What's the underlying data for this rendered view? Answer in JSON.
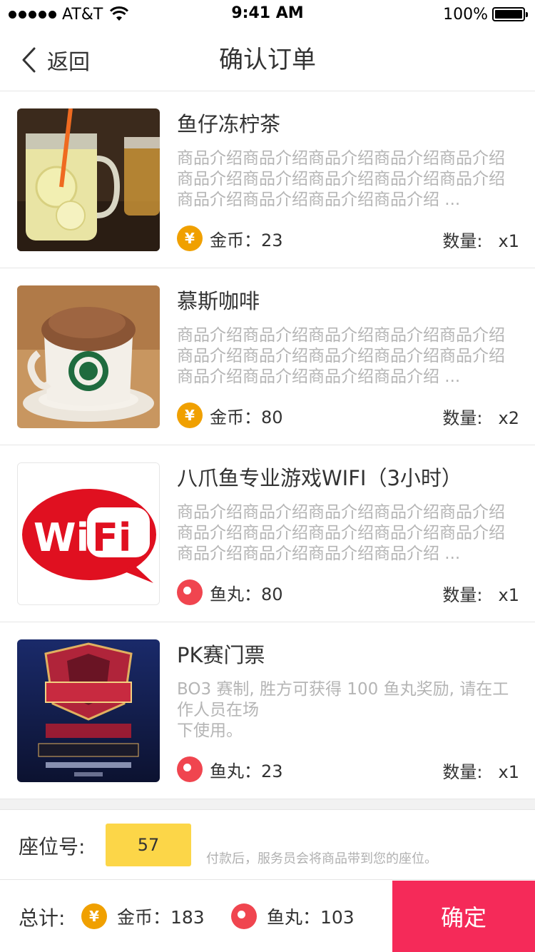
{
  "status_bar": {
    "carrier": "AT&T",
    "time": "9:41 AM",
    "battery": "100%"
  },
  "nav": {
    "back_label": "返回",
    "title": "确认订单"
  },
  "items": [
    {
      "title": "鱼仔冻柠茶",
      "desc": "商品介绍商品介绍商品介绍商品介绍商品介绍商品介绍商品介绍商品介绍商品介绍商品介绍商品介绍商品介绍商品介绍商品介绍 ...",
      "price_label": "金币：23",
      "currency_icon": "coin-icon",
      "qty_label": "数量:",
      "qty_value": "x1"
    },
    {
      "title": "慕斯咖啡",
      "desc": "商品介绍商品介绍商品介绍商品介绍商品介绍商品介绍商品介绍商品介绍商品介绍商品介绍商品介绍商品介绍商品介绍商品介绍 ...",
      "price_label": "金币：80",
      "currency_icon": "coin-icon",
      "qty_label": "数量:",
      "qty_value": "x2"
    },
    {
      "title": "八爪鱼专业游戏WIFI（3小时）",
      "desc": "商品介绍商品介绍商品介绍商品介绍商品介绍商品介绍商品介绍商品介绍商品介绍商品介绍商品介绍商品介绍商品介绍商品介绍 ...",
      "price_label": "鱼丸：80",
      "currency_icon": "ball-icon",
      "qty_label": "数量:",
      "qty_value": "x1",
      "thumb_text_a": "Wi",
      "thumb_text_b": "Fi"
    },
    {
      "title": "PK赛门票",
      "desc_line1": "BO3 赛制, 胜方可获得 100 鱼丸奖励, 请在工作人员在场",
      "desc_line2": "下使用。",
      "price_label": "鱼丸：23",
      "currency_icon": "ball-icon",
      "qty_label": "数量:",
      "qty_value": "x1"
    }
  ],
  "seat": {
    "label": "座位号:",
    "value": "57",
    "hint": "付款后，服务员会将商品带到您的座位。"
  },
  "footer": {
    "total_label": "总计:",
    "coin_total": "金币：183",
    "ball_total": "鱼丸：103",
    "confirm_label": "确定"
  },
  "colors": {
    "accent": "#f52a59",
    "coin": "#f0a000",
    "ball": "#f0454f",
    "seat_bg": "#fcd648"
  }
}
